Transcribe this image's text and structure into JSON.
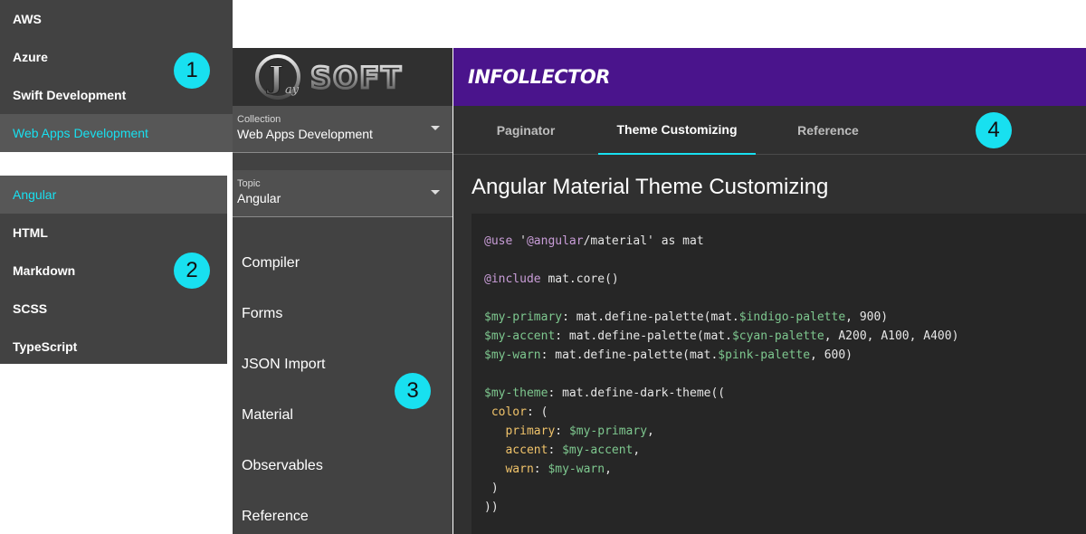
{
  "collection_menu": {
    "options": [
      "AWS",
      "Azure",
      "Swift Development",
      "Web Apps Development"
    ],
    "selected": "Web Apps Development"
  },
  "topic_menu": {
    "options": [
      "Angular",
      "HTML",
      "Markdown",
      "SCSS",
      "TypeScript"
    ],
    "selected": "Angular"
  },
  "nav": {
    "logo_text": "JaySOFT",
    "collection": {
      "label": "Collection",
      "value": "Web Apps Development"
    },
    "topic": {
      "label": "Topic",
      "value": "Angular"
    },
    "items": [
      "Compiler",
      "Forms",
      "JSON Import",
      "Material",
      "Observables",
      "Reference"
    ]
  },
  "header": {
    "brand": "INFOLLECTOR"
  },
  "tabs": [
    {
      "label": "Paginator"
    },
    {
      "label": "Theme Customizing",
      "active": true
    },
    {
      "label": "Reference"
    }
  ],
  "content": {
    "title": "Angular Material Theme Customizing",
    "code_lines": [
      "@use '@angular/material' as mat",
      "",
      "@include mat.core()",
      "",
      "$my-primary: mat.define-palette(mat.$indigo-palette, 900)",
      "$my-accent: mat.define-palette(mat.$cyan-palette, A200, A100, A400)",
      "$my-warn: mat.define-palette(mat.$pink-palette, 600)",
      "",
      "$my-theme: mat.define-dark-theme((",
      " color: (",
      "   primary: $my-primary,",
      "   accent: $my-accent,",
      "   warn: $my-warn,",
      " )",
      "))"
    ]
  },
  "callouts": [
    "1",
    "2",
    "3",
    "4"
  ],
  "colors": {
    "accent": "#18e0f0",
    "header": "#4a148c",
    "panel": "#424242",
    "background": "#303030"
  }
}
